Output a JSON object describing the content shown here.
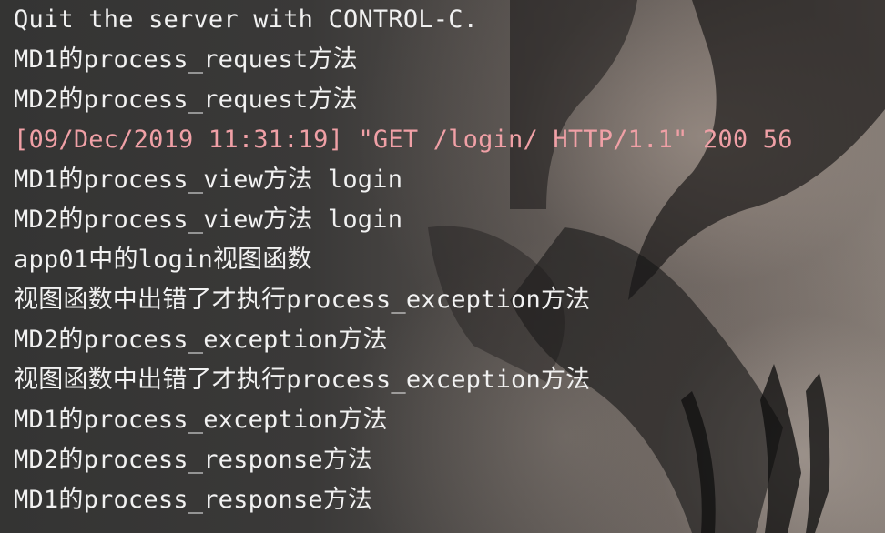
{
  "terminal": {
    "highlight_color": "#f0a0a6",
    "text_color": "#f1f1f1",
    "lines": [
      "Quit the server with CONTROL-C.",
      "MD1的process_request方法",
      "MD2的process_request方法",
      "[09/Dec/2019 11:31:19] \"GET /login/ HTTP/1.1\" 200 56",
      "MD1的process_view方法 login",
      "MD2的process_view方法 login",
      "app01中的login视图函数",
      "视图函数中出错了才执行process_exception方法",
      "MD2的process_exception方法",
      "视图函数中出错了才执行process_exception方法",
      "MD1的process_exception方法",
      "MD2的process_response方法",
      "MD1的process_response方法"
    ]
  }
}
